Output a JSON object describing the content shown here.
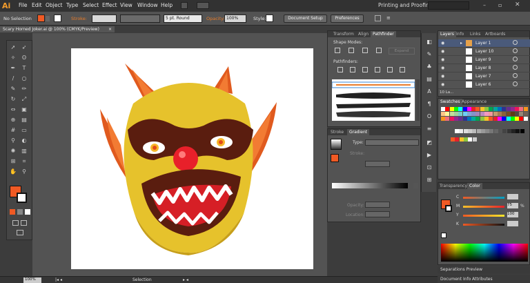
{
  "app": {
    "logo": "Ai"
  },
  "menu": [
    "File",
    "Edit",
    "Object",
    "Type",
    "Select",
    "Effect",
    "View",
    "Window",
    "Help"
  ],
  "workspace": {
    "label": "Printing and Proofing"
  },
  "control": {
    "selection": "No Selection",
    "stroke_label": "Stroke:",
    "brush": "5 pt. Round",
    "opacity_label": "Opacity:",
    "opacity_value": "100%",
    "style_label": "Style:",
    "doc_setup": "Document Setup",
    "preferences": "Preferences",
    "fill_color": "#f05a24",
    "accent": "#e87c2a"
  },
  "document": {
    "tab": "Scary Horned Joker.ai @ 100% (CMYK/Preview)"
  },
  "status": {
    "zoom": "100%",
    "tool": "Selection"
  },
  "pathfinder": {
    "tabs": [
      "Transform",
      "Align",
      "Pathfinder"
    ],
    "shape_modes": "Shape Modes:",
    "pathfinders": "Pathfinders:",
    "expand": "Expand"
  },
  "gradient": {
    "tabs": [
      "Stroke",
      "Gradient"
    ],
    "type": "Type:",
    "stroke": "Stroke:",
    "opacity": "Opacity:",
    "location": "Location:"
  },
  "layers": {
    "tabs": [
      "Layers",
      "Info",
      "Links",
      "Artboards"
    ],
    "rows": [
      "Layer 1",
      "Layer 10",
      "Layer 9",
      "Layer 8",
      "Layer 7",
      "Layer 6"
    ],
    "count": "10 La..."
  },
  "swatches": {
    "tabs": [
      "Swatches",
      "Appearance"
    ]
  },
  "transparency": {
    "tabs": [
      "Transparency",
      "Color"
    ],
    "channels": [
      {
        "label": "C",
        "value": ""
      },
      {
        "label": "M",
        "value": "75"
      },
      {
        "label": "Y",
        "value": "100"
      },
      {
        "label": "K",
        "value": ""
      }
    ],
    "percent": "%"
  },
  "bottom_panels": {
    "separations": "Separations Preview",
    "doc_info": "Document Info",
    "attributes": "Attributes"
  }
}
